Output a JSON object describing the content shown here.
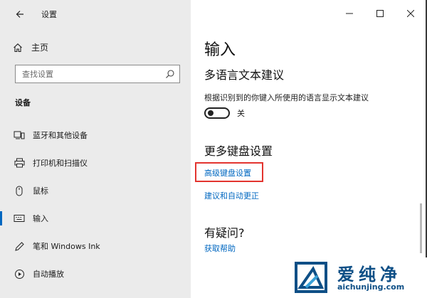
{
  "window": {
    "title": "设置"
  },
  "sidebar": {
    "home_label": "主页",
    "search_placeholder": "查找设置",
    "section_header": "设备",
    "items": [
      {
        "label": "蓝牙和其他设备",
        "icon": "bluetooth-devices-icon"
      },
      {
        "label": "打印机和扫描仪",
        "icon": "printer-icon"
      },
      {
        "label": "鼠标",
        "icon": "mouse-icon"
      },
      {
        "label": "输入",
        "icon": "keyboard-icon",
        "active": true
      },
      {
        "label": "笔和 Windows Ink",
        "icon": "pen-icon"
      },
      {
        "label": "自动播放",
        "icon": "autoplay-icon"
      }
    ]
  },
  "content": {
    "title": "输入",
    "multilang": {
      "title": "多语言文本建议",
      "description": "根据识别到的你键入所使用的语言显示文本建议",
      "toggle_state": "关"
    },
    "more_keyboard": {
      "title": "更多键盘设置",
      "links": [
        "高级键盘设置",
        "建议和自动更正"
      ]
    },
    "help": {
      "title": "有疑问?",
      "link": "获取帮助"
    }
  },
  "watermark": {
    "brand": "爱纯净",
    "url": "aichunjing.com"
  },
  "colors": {
    "accent": "#0067c0",
    "highlight": "#e3342f",
    "sidebar_bg": "#ebebeb",
    "watermark": "#0e4f86"
  }
}
